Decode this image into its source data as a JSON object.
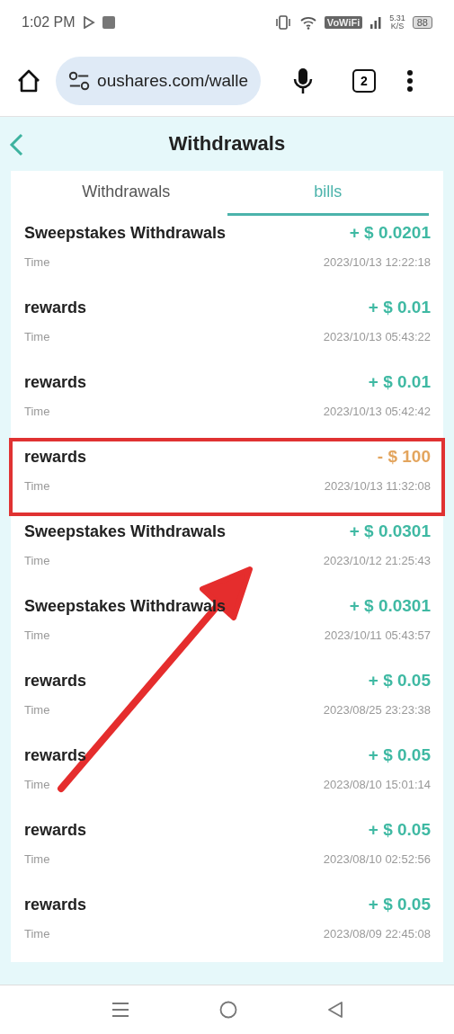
{
  "status_bar": {
    "time": "1:02 PM",
    "network_badge": "VoWiFi",
    "speed": "5.31",
    "speed_unit": "K/S",
    "battery": "88"
  },
  "browser": {
    "url": "oushares.com/walle",
    "tab_count": "2"
  },
  "header": {
    "title": "Withdrawals"
  },
  "tabs": [
    {
      "label": "Withdrawals",
      "selected": false
    },
    {
      "label": "bills",
      "selected": true
    }
  ],
  "bills": [
    {
      "title": "Sweepstakes Withdrawals",
      "amount": "+ $ 0.0201",
      "kind": "credit",
      "time_label": "Time",
      "time": "2023/10/13 12:22:18",
      "highlighted": false
    },
    {
      "title": "rewards",
      "amount": "+ $ 0.01",
      "kind": "credit",
      "time_label": "Time",
      "time": "2023/10/13 05:43:22",
      "highlighted": false
    },
    {
      "title": "rewards",
      "amount": "+ $ 0.01",
      "kind": "credit",
      "time_label": "Time",
      "time": "2023/10/13 05:42:42",
      "highlighted": false
    },
    {
      "title": "rewards",
      "amount": "- $ 100",
      "kind": "debit",
      "time_label": "Time",
      "time": "2023/10/13 11:32:08",
      "highlighted": true
    },
    {
      "title": "Sweepstakes Withdrawals",
      "amount": "+ $ 0.0301",
      "kind": "credit",
      "time_label": "Time",
      "time": "2023/10/12 21:25:43",
      "highlighted": false
    },
    {
      "title": "Sweepstakes Withdrawals",
      "amount": "+ $ 0.0301",
      "kind": "credit",
      "time_label": "Time",
      "time": "2023/10/11 05:43:57",
      "highlighted": false
    },
    {
      "title": "rewards",
      "amount": "+ $ 0.05",
      "kind": "credit",
      "time_label": "Time",
      "time": "2023/08/25 23:23:38",
      "highlighted": false
    },
    {
      "title": "rewards",
      "amount": "+ $ 0.05",
      "kind": "credit",
      "time_label": "Time",
      "time": "2023/08/10 15:01:14",
      "highlighted": false
    },
    {
      "title": "rewards",
      "amount": "+ $ 0.05",
      "kind": "credit",
      "time_label": "Time",
      "time": "2023/08/10 02:52:56",
      "highlighted": false
    },
    {
      "title": "rewards",
      "amount": "+ $ 0.05",
      "kind": "credit",
      "time_label": "Time",
      "time": "2023/08/09 22:45:08",
      "highlighted": false
    }
  ]
}
